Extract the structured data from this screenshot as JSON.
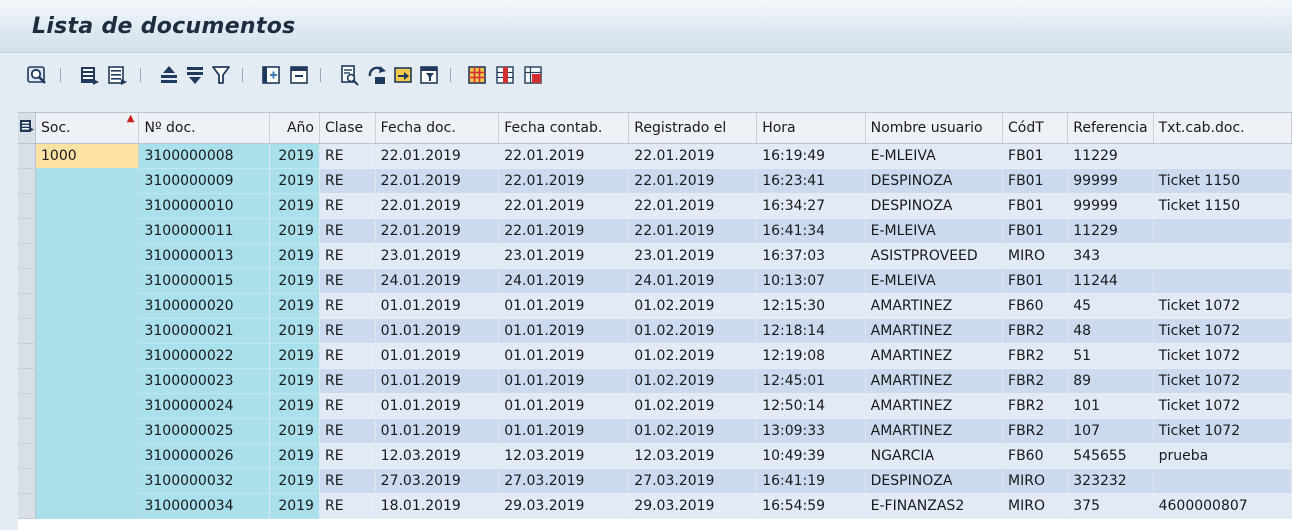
{
  "window": {
    "title": "Lista de documentos"
  },
  "toolbar": {
    "icons": [
      "details-icon",
      "select-all-icon",
      "deselect-all-icon",
      "sort-ascending-icon",
      "sort-descending-icon",
      "filter-icon",
      "total-icon",
      "subtotal-icon",
      "print-preview-icon",
      "export-icon",
      "send-icon",
      "abc-analysis-icon",
      "choose-layout-icon",
      "change-layout-icon",
      "save-layout-icon"
    ],
    "colors": {
      "icon_dark": "#1e3a5c",
      "icon_accent": "#3d7ebd",
      "icon_yellow": "#f2c94c",
      "icon_red": "#d03030"
    }
  },
  "table": {
    "columns": [
      "Soc.",
      "Nº doc.",
      "Año",
      "Clase",
      "Fecha doc.",
      "Fecha contab.",
      "Registrado el",
      "Hora",
      "Nombre usuario",
      "CódT",
      "Referencia",
      "Txt.cab.doc."
    ],
    "sorted_column": "Soc.",
    "rows": [
      [
        "1000",
        "3100000008",
        "2019",
        "RE",
        "22.01.2019",
        "22.01.2019",
        "22.01.2019",
        "16:19:49",
        "E-MLEIVA",
        "FB01",
        "11229",
        ""
      ],
      [
        "",
        "3100000009",
        "2019",
        "RE",
        "22.01.2019",
        "22.01.2019",
        "22.01.2019",
        "16:23:41",
        "DESPINOZA",
        "FB01",
        "99999",
        "Ticket 1150"
      ],
      [
        "",
        "3100000010",
        "2019",
        "RE",
        "22.01.2019",
        "22.01.2019",
        "22.01.2019",
        "16:34:27",
        "DESPINOZA",
        "FB01",
        "99999",
        "Ticket 1150"
      ],
      [
        "",
        "3100000011",
        "2019",
        "RE",
        "22.01.2019",
        "22.01.2019",
        "22.01.2019",
        "16:41:34",
        "E-MLEIVA",
        "FB01",
        "11229",
        ""
      ],
      [
        "",
        "3100000013",
        "2019",
        "RE",
        "23.01.2019",
        "23.01.2019",
        "23.01.2019",
        "16:37:03",
        "ASISTPROVEED",
        "MIRO",
        "343",
        ""
      ],
      [
        "",
        "3100000015",
        "2019",
        "RE",
        "24.01.2019",
        "24.01.2019",
        "24.01.2019",
        "10:13:07",
        "E-MLEIVA",
        "FB01",
        "11244",
        ""
      ],
      [
        "",
        "3100000020",
        "2019",
        "RE",
        "01.01.2019",
        "01.01.2019",
        "01.02.2019",
        "12:15:30",
        "AMARTINEZ",
        "FB60",
        "45",
        "Ticket 1072"
      ],
      [
        "",
        "3100000021",
        "2019",
        "RE",
        "01.01.2019",
        "01.01.2019",
        "01.02.2019",
        "12:18:14",
        "AMARTINEZ",
        "FBR2",
        "48",
        "Ticket 1072"
      ],
      [
        "",
        "3100000022",
        "2019",
        "RE",
        "01.01.2019",
        "01.01.2019",
        "01.02.2019",
        "12:19:08",
        "AMARTINEZ",
        "FBR2",
        "51",
        "Ticket 1072"
      ],
      [
        "",
        "3100000023",
        "2019",
        "RE",
        "01.01.2019",
        "01.01.2019",
        "01.02.2019",
        "12:45:01",
        "AMARTINEZ",
        "FBR2",
        "89",
        "Ticket 1072"
      ],
      [
        "",
        "3100000024",
        "2019",
        "RE",
        "01.01.2019",
        "01.01.2019",
        "01.02.2019",
        "12:50:14",
        "AMARTINEZ",
        "FBR2",
        "101",
        "Ticket 1072"
      ],
      [
        "",
        "3100000025",
        "2019",
        "RE",
        "01.01.2019",
        "01.01.2019",
        "01.02.2019",
        "13:09:33",
        "AMARTINEZ",
        "FBR2",
        "107",
        "Ticket 1072"
      ],
      [
        "",
        "3100000026",
        "2019",
        "RE",
        "12.03.2019",
        "12.03.2019",
        "12.03.2019",
        "10:49:39",
        "NGARCIA",
        "FB60",
        "545655",
        "prueba"
      ],
      [
        "",
        "3100000032",
        "2019",
        "RE",
        "27.03.2019",
        "27.03.2019",
        "27.03.2019",
        "16:41:19",
        "DESPINOZA",
        "MIRO",
        "323232",
        ""
      ],
      [
        "",
        "3100000034",
        "2019",
        "RE",
        "18.01.2019",
        "29.03.2019",
        "29.03.2019",
        "16:54:59",
        "E-FINANZAS2",
        "MIRO",
        "375",
        "4600000807"
      ]
    ]
  },
  "colors": {
    "key_column": "#a9e0ec",
    "selected_cell": "#fce3a4",
    "row_light": "#e1eaf6",
    "row_dark": "#ccdaf0",
    "header": "#eef1f5"
  }
}
